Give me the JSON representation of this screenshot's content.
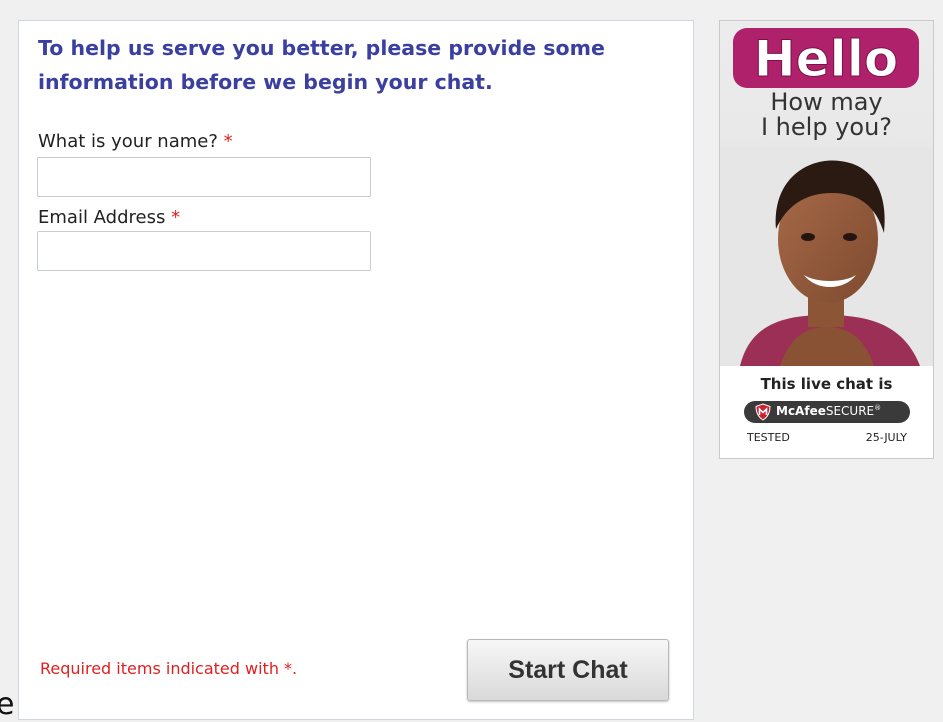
{
  "form": {
    "intro_text": "To help us serve you better, please provide some information before we begin your chat.",
    "name_label": "What is your name?",
    "name_value": "",
    "email_label": "Email Address",
    "email_value": "",
    "required_star": "*",
    "required_note": "Required items indicated with *.",
    "start_chat_label": "Start Chat",
    "edge_glyph": "e"
  },
  "ad": {
    "logo_text": "Hello",
    "tagline": "How may\nI help you?",
    "live_chat_text": "This live chat is",
    "badge_brand": "McAfee",
    "badge_word": "SECURE",
    "badge_tm": "®",
    "tested_label": "TESTED",
    "tested_date": "25-JULY"
  },
  "colors": {
    "page_background": "#f0f0f0",
    "intro_text": "#3b40a0",
    "required_red": "#e02020",
    "logo_magenta": "#b0216b",
    "badge_dark": "#3a3a3a",
    "shield_red": "#cc1f2f"
  },
  "icons": {
    "logo": "hello-logo",
    "badge_shield": "mcafee-shield-icon"
  }
}
